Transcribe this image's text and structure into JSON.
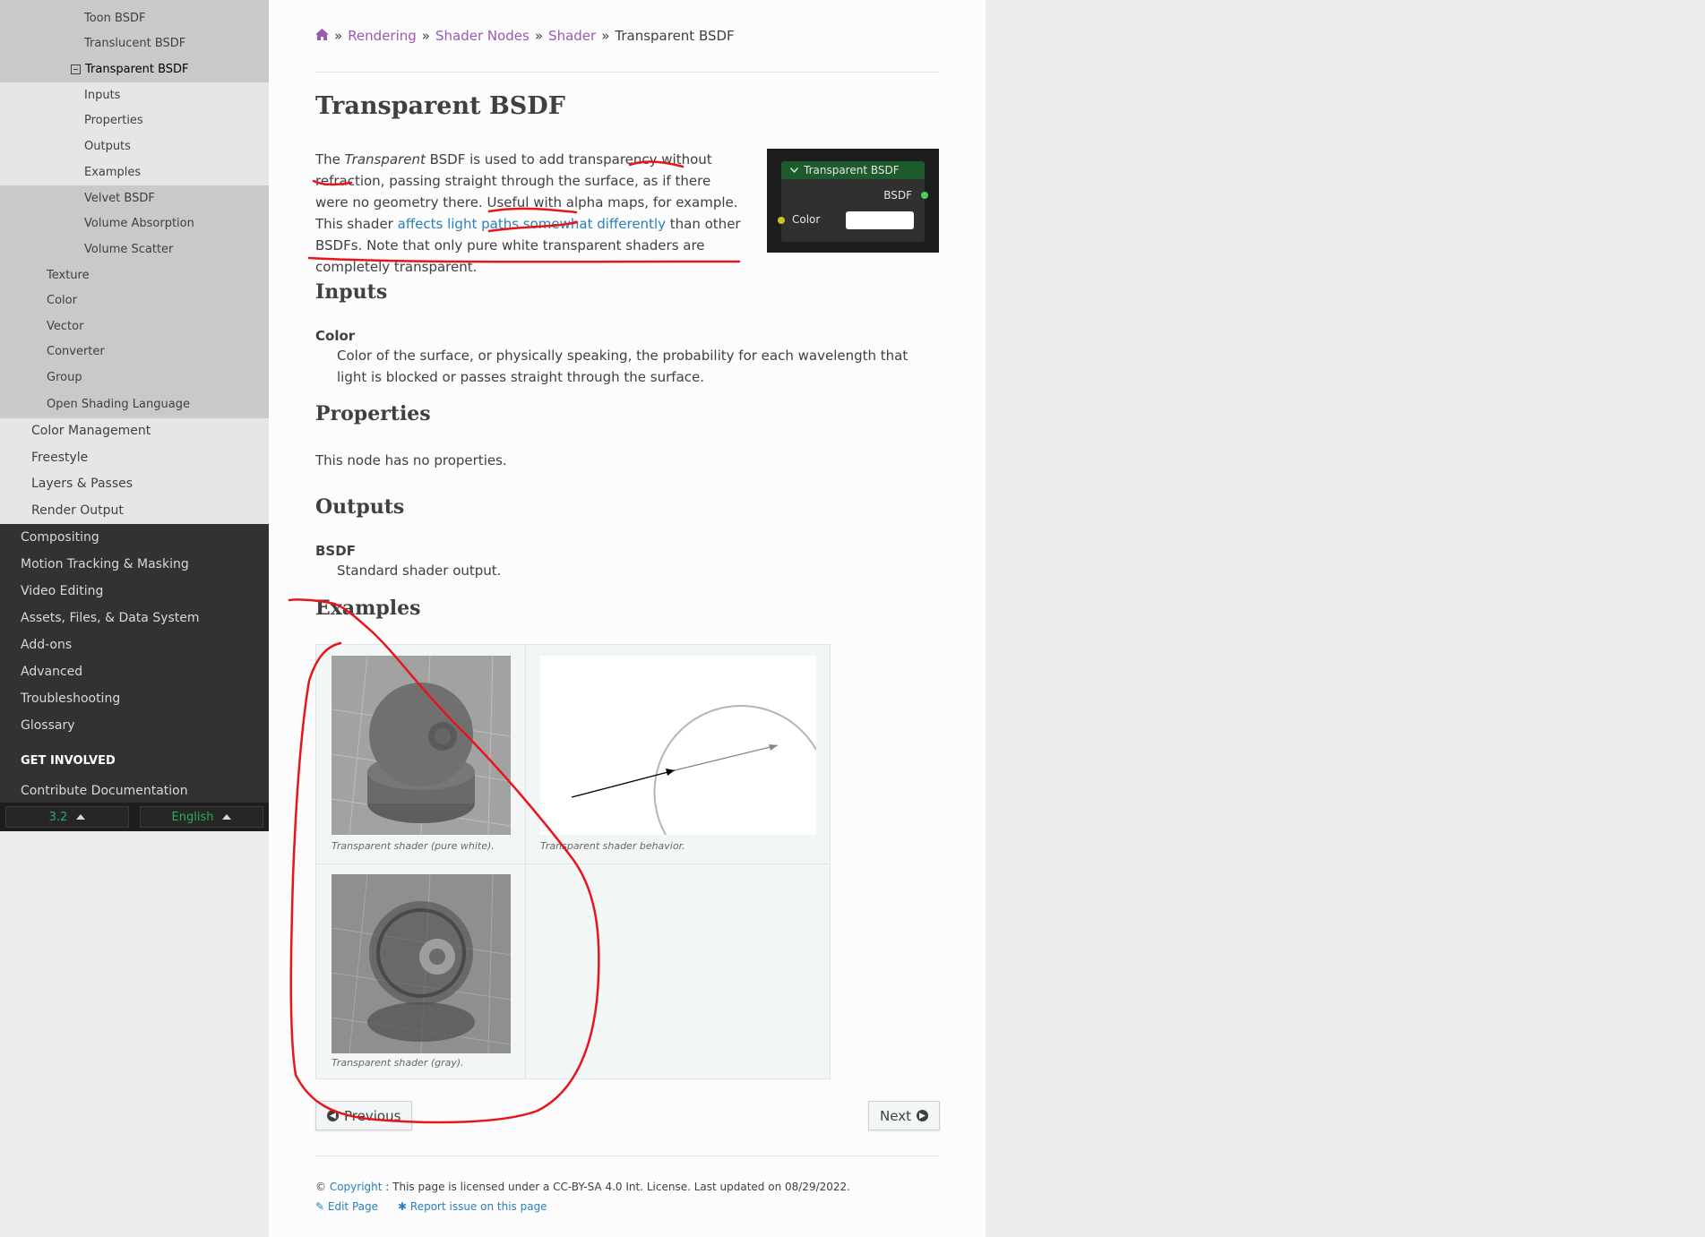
{
  "sidebar": {
    "mid_items_top": [
      {
        "label": "Toon BSDF"
      },
      {
        "label": "Translucent BSDF"
      },
      {
        "label": "Transparent BSDF"
      }
    ],
    "sub_items": [
      {
        "label": "Inputs"
      },
      {
        "label": "Properties"
      },
      {
        "label": "Outputs"
      },
      {
        "label": "Examples"
      }
    ],
    "mid_items_bottom": [
      {
        "label": "Velvet BSDF"
      },
      {
        "label": "Volume Absorption"
      },
      {
        "label": "Volume Scatter"
      }
    ],
    "l3_items": [
      {
        "label": "Texture"
      },
      {
        "label": "Color"
      },
      {
        "label": "Vector"
      },
      {
        "label": "Converter"
      },
      {
        "label": "Group"
      },
      {
        "label": "Open Shading Language"
      }
    ],
    "l2_items": [
      {
        "label": "Color Management"
      },
      {
        "label": "Freestyle"
      },
      {
        "label": "Layers & Passes"
      },
      {
        "label": "Render Output"
      }
    ],
    "top_items": [
      {
        "label": "Compositing"
      },
      {
        "label": "Motion Tracking & Masking"
      },
      {
        "label": "Video Editing"
      },
      {
        "label": "Assets, Files, & Data System"
      },
      {
        "label": "Add-ons"
      },
      {
        "label": "Advanced"
      },
      {
        "label": "Troubleshooting"
      },
      {
        "label": "Glossary"
      }
    ],
    "caption": "GET INVOLVED",
    "contribute": "Contribute Documentation",
    "version": "3.2",
    "language": "English"
  },
  "breadcrumb": {
    "items": [
      "Rendering",
      "Shader Nodes",
      "Shader"
    ],
    "sep": "»",
    "current": "Transparent BSDF"
  },
  "page": {
    "title": "Transparent BSDF",
    "intro": {
      "p1": "The ",
      "em": "Transparent",
      "p2": " BSDF is used to add transparency without refraction, passing straight through the surface, as if there were no geometry there. Useful with alpha maps, for example. This shader ",
      "link": "affects light paths somewhat differently",
      "p3": " than other BSDFs. Note that only pure white transparent shaders are completely transparent."
    },
    "node": {
      "title": "Transparent BSDF",
      "output": "BSDF",
      "input": "Color"
    },
    "inputs_heading": "Inputs",
    "inputs_term": "Color",
    "inputs_def": "Color of the surface, or physically speaking, the probability for each wavelength that light is blocked or passes straight through the surface.",
    "properties_heading": "Properties",
    "properties_text": "This node has no properties.",
    "outputs_heading": "Outputs",
    "outputs_term": "BSDF",
    "outputs_def": "Standard shader output.",
    "examples_heading": "Examples",
    "captions": {
      "white": "Transparent shader (pure white).",
      "behavior": "Transparent shader behavior.",
      "gray": "Transparent shader (gray)."
    },
    "prev": "Previous",
    "next": "Next"
  },
  "footer": {
    "copy_sym": "©",
    "copyright": "Copyright",
    "license": ": This page is licensed under a CC-BY-SA 4.0 Int. License. Last updated on 08/29/2022.",
    "edit": "Edit Page",
    "report": "Report issue on this page"
  },
  "colors": {
    "link": "#2980b9",
    "breadcrumb": "#9b59b6",
    "annotation": "#e8141a",
    "sidebar_dark": "#343131"
  }
}
